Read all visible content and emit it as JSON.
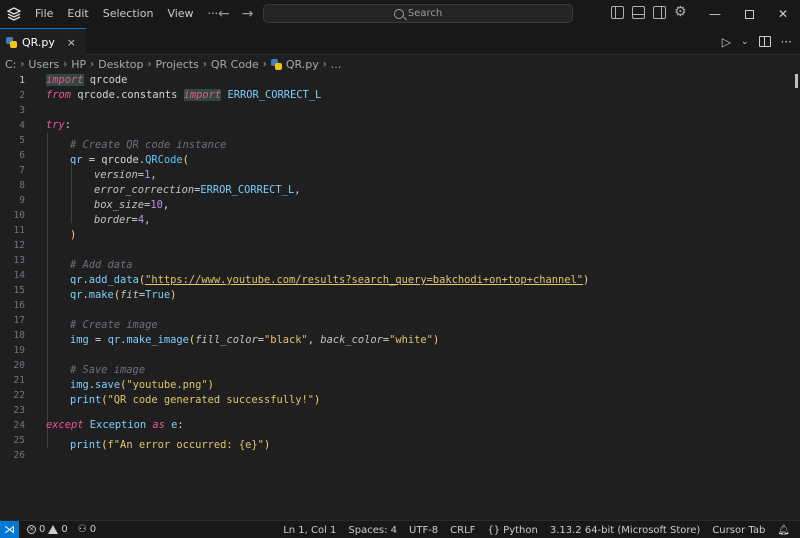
{
  "titlebar": {
    "menu": [
      "File",
      "Edit",
      "Selection",
      "View"
    ],
    "more": "···",
    "search_placeholder": "Search"
  },
  "tab": {
    "label": "QR.py",
    "close": "×"
  },
  "breadcrumb": [
    "C:",
    "Users",
    "HP",
    "Desktop",
    "Projects",
    "QR Code",
    "QR.py",
    "..."
  ],
  "editor": {
    "active_line": 1,
    "line_numbers": [
      "1",
      "2",
      "3",
      "4",
      "5",
      "6",
      "7",
      "8",
      "9",
      "10",
      "11",
      "12",
      "13",
      "14",
      "15",
      "16",
      "17",
      "18",
      "19",
      "20",
      "21",
      "22",
      "23",
      "24",
      "25",
      "26"
    ]
  },
  "code": {
    "l1": [
      "import",
      " qrcode"
    ],
    "l2": [
      "from",
      " qrcode.constants ",
      "import",
      " ERROR_CORRECT_L"
    ],
    "l4": [
      "try",
      ":"
    ],
    "l5": "# Create QR code instance",
    "l6": [
      "qr",
      " = qrcode.",
      "QRCode",
      "("
    ],
    "l7": [
      "version",
      "=",
      "1",
      ","
    ],
    "l8": [
      "error_correction",
      "=",
      "ERROR_CORRECT_L",
      ","
    ],
    "l9": [
      "box_size",
      "=",
      "10",
      ","
    ],
    "l10": [
      "border",
      "=",
      "4",
      ","
    ],
    "l11": ")",
    "l13": "# Add data",
    "l14": [
      "qr",
      ".",
      "add_data",
      "(",
      "\"https://www.youtube.com/results?search_query=bakchodi+on+top+channel\"",
      ")"
    ],
    "l15": [
      "qr",
      ".",
      "make",
      "(",
      "fit",
      "=",
      "True",
      ")"
    ],
    "l17": "# Create image",
    "l18": [
      "img",
      " = ",
      "qr",
      ".",
      "make_image",
      "(",
      "fill_color",
      "=",
      "\"black\"",
      ", ",
      "back_color",
      "=",
      "\"white\"",
      ")"
    ],
    "l20": "# Save image",
    "l21": [
      "img",
      ".",
      "save",
      "(",
      "\"youtube.png\"",
      ")"
    ],
    "l22": [
      "print",
      "(",
      "\"QR code generated successfully!\"",
      ")"
    ],
    "l24": [
      "except",
      " Exception ",
      "as",
      " e",
      ":"
    ],
    "l25": [
      "print",
      "(",
      "f\"An error occurred: {e}\"",
      ")"
    ]
  },
  "statusbar": {
    "errors": "0",
    "warnings": "0",
    "ports": "0",
    "position": "Ln 1, Col 1",
    "spaces": "Spaces: 4",
    "encoding": "UTF-8",
    "eol": "CRLF",
    "language": "Python",
    "interpreter": "3.13.2 64-bit (Microsoft Store)",
    "cursor_tab": "Cursor Tab"
  },
  "colors": {
    "accent": "#0078d4",
    "keyword": "#ee5396",
    "string": "#e0c46c",
    "identifier": "#7dcfff",
    "comment": "#6f6f7f"
  },
  "icons": [
    "app-logo-icon",
    "back-arrow-icon",
    "forward-arrow-icon",
    "search-icon",
    "toggle-primary-sidebar-icon",
    "toggle-panel-icon",
    "toggle-secondary-sidebar-icon",
    "gear-icon",
    "minimize-icon",
    "maximize-icon",
    "close-icon",
    "python-file-icon",
    "run-icon",
    "split-editor-icon",
    "remote-icon",
    "error-icon",
    "warning-icon",
    "ports-icon",
    "bell-icon"
  ]
}
